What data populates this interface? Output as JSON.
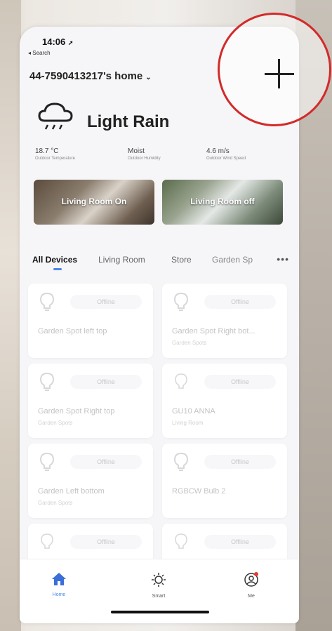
{
  "status_bar": {
    "time": "14:06",
    "back_label": "◂ Search"
  },
  "home": {
    "title": "44-7590413217's home",
    "chevron": "⌄"
  },
  "weather": {
    "icon": "cloud-rain-icon",
    "condition": "Light Rain",
    "stats": [
      {
        "value": "18.7 °C",
        "label": "Outdoor Temperature"
      },
      {
        "value": "Moist",
        "label": "Outdoor Humidity"
      },
      {
        "value": "4.6 m/s",
        "label": "Outdoor Wind Speed"
      }
    ]
  },
  "scenes": [
    {
      "label": "Living Room On"
    },
    {
      "label": "Living Room off"
    }
  ],
  "tabs": [
    {
      "label": "All Devices"
    },
    {
      "label": "Living Room"
    },
    {
      "label": "Store"
    },
    {
      "label": "Garden Sp"
    }
  ],
  "tabs_more": "•••",
  "devices": [
    {
      "name": "Garden Spot left top",
      "room": "",
      "state": "Offline"
    },
    {
      "name": "Garden Spot Right bot...",
      "room": "Garden Spots",
      "state": "Offline"
    },
    {
      "name": "Garden Spot Right top",
      "room": "Garden Spots",
      "state": "Offline"
    },
    {
      "name": "GU10 ANNA",
      "room": "Living Room",
      "state": "Offline"
    },
    {
      "name": "Garden Left bottom",
      "room": "Garden Spots",
      "state": "Offline"
    },
    {
      "name": "RGBCW Bulb 2",
      "room": "",
      "state": "Offline"
    },
    {
      "name": "",
      "room": "",
      "state": "Offline"
    },
    {
      "name": "",
      "room": "",
      "state": "Offline"
    }
  ],
  "nav": [
    {
      "label": "Home",
      "icon": "home-icon"
    },
    {
      "label": "Smart",
      "icon": "sun-icon"
    },
    {
      "label": "Me",
      "icon": "user-icon"
    }
  ],
  "colors": {
    "accent": "#4a86e8",
    "highlight_ring": "#d32a2a",
    "notification_dot": "#e53935"
  }
}
